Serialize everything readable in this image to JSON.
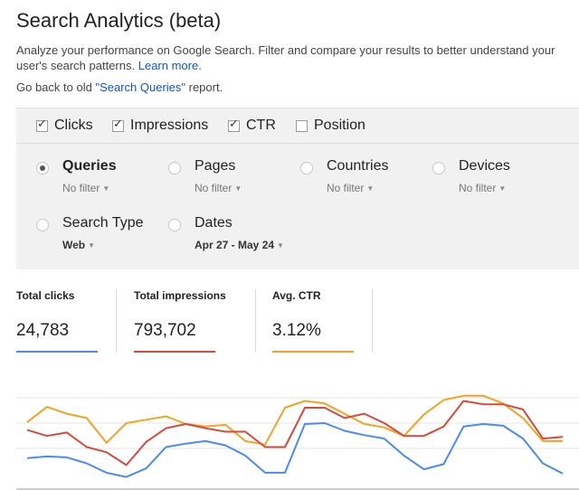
{
  "header": {
    "title": "Search Analytics (beta)",
    "description": "Analyze your performance on Google Search. Filter and compare your results to better understand your user's search patterns.",
    "learn_more": "Learn more.",
    "back_prefix": "Go back to old ",
    "back_link": "\"Search Queries\"",
    "back_suffix": " report."
  },
  "metrics": [
    {
      "label": "Clicks",
      "checked": true
    },
    {
      "label": "Impressions",
      "checked": true
    },
    {
      "label": "CTR",
      "checked": true
    },
    {
      "label": "Position",
      "checked": false
    }
  ],
  "dimensions": [
    {
      "label": "Queries",
      "filter": "No filter",
      "selected": true
    },
    {
      "label": "Pages",
      "filter": "No filter",
      "selected": false
    },
    {
      "label": "Countries",
      "filter": "No filter",
      "selected": false
    },
    {
      "label": "Devices",
      "filter": "No filter",
      "selected": false
    },
    {
      "label": "Search Type",
      "filter": "Web",
      "selected": false
    },
    {
      "label": "Dates",
      "filter": "Apr 27 - May 24",
      "selected": false
    }
  ],
  "totals": [
    {
      "label": "Total clicks",
      "value": "24,783",
      "color": "#4a8af4"
    },
    {
      "label": "Total impressions",
      "value": "793,702",
      "color": "#d64a3b"
    },
    {
      "label": "Avg. CTR",
      "value": "3.12%",
      "color": "#f4a223"
    }
  ],
  "chart_data": {
    "type": "line",
    "x": [
      1,
      2,
      3,
      4,
      5,
      6,
      7,
      8,
      9,
      10,
      11,
      12,
      13,
      14,
      15,
      16,
      17,
      18,
      19,
      20,
      21,
      22,
      23,
      24,
      25,
      26,
      27,
      28
    ],
    "series": [
      {
        "color": "#4a8af4",
        "values": [
          33,
          35,
          34,
          27,
          16,
          11,
          21,
          46,
          50,
          53,
          48,
          36,
          16,
          16,
          73,
          74,
          65,
          60,
          56,
          36,
          20,
          26,
          70,
          73,
          71,
          56,
          27,
          15
        ]
      },
      {
        "color": "#d64a3b",
        "values": [
          66,
          59,
          63,
          46,
          40,
          25,
          52,
          68,
          73,
          68,
          64,
          64,
          46,
          46,
          92,
          92,
          80,
          85,
          74,
          59,
          59,
          70,
          100,
          96,
          96,
          90,
          56,
          58
        ]
      },
      {
        "color": "#f4a223",
        "values": [
          75,
          93,
          85,
          80,
          51,
          74,
          78,
          82,
          73,
          70,
          72,
          53,
          49,
          92,
          100,
          97,
          85,
          73,
          69,
          59,
          84,
          101,
          106,
          106,
          97,
          80,
          53,
          53
        ]
      }
    ],
    "grid": true,
    "legend": "none"
  }
}
